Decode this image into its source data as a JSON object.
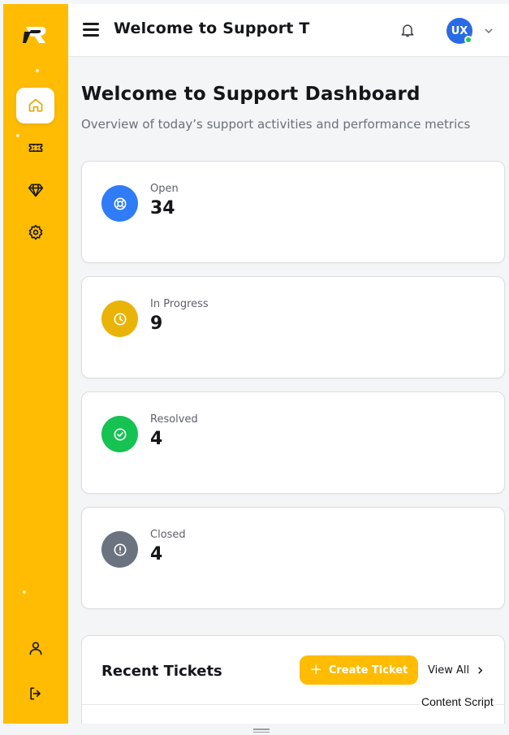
{
  "header": {
    "title": "Welcome to Support T",
    "avatar_initials": "UX"
  },
  "page": {
    "title": "Welcome to Support Dashboard",
    "subtitle": "Overview of today’s support activities and performance metrics"
  },
  "stats": [
    {
      "label": "Open",
      "value": "34",
      "color": "#2f7cf6",
      "icon": "lifebuoy-icon"
    },
    {
      "label": "In Progress",
      "value": "9",
      "color": "#eab308",
      "icon": "clock-icon"
    },
    {
      "label": "Resolved",
      "value": "4",
      "color": "#16c252",
      "icon": "check-circle-icon"
    },
    {
      "label": "Closed",
      "value": "4",
      "color": "#6b7280",
      "icon": "alert-circle-icon"
    }
  ],
  "tickets": {
    "title": "Recent Tickets",
    "create_label": "Create Ticket",
    "view_all_label": "View All"
  },
  "overlay": {
    "content_script": "Content Script"
  },
  "colors": {
    "sidebar": "#ffbc02",
    "accent": "#ffbc02",
    "avatar": "#2a6ae6",
    "online": "#22c55e"
  }
}
